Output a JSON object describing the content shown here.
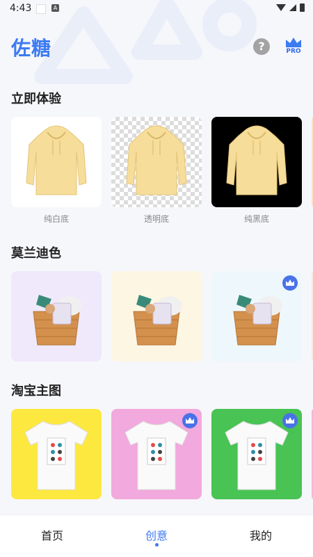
{
  "status": {
    "time": "4:43"
  },
  "header": {
    "title": "佐糖",
    "pro_label": "PRO",
    "help_label": "?"
  },
  "sections": [
    {
      "title": "立即体验",
      "captions": [
        "纯白底",
        "透明底",
        "纯黑底"
      ]
    },
    {
      "title": "莫兰迪色"
    },
    {
      "title": "淘宝主图"
    }
  ],
  "colors": {
    "accent": "#3d7bf3",
    "hoodie": "#f6dd9a",
    "morandi": [
      "#efe9fb",
      "#fdf6e3",
      "#eef8fc"
    ],
    "taobao": [
      "#fde840",
      "#f2a9dd",
      "#48c354"
    ]
  },
  "tabs": [
    {
      "label": "首页",
      "active": false
    },
    {
      "label": "创意",
      "active": true
    },
    {
      "label": "我的",
      "active": false
    }
  ]
}
